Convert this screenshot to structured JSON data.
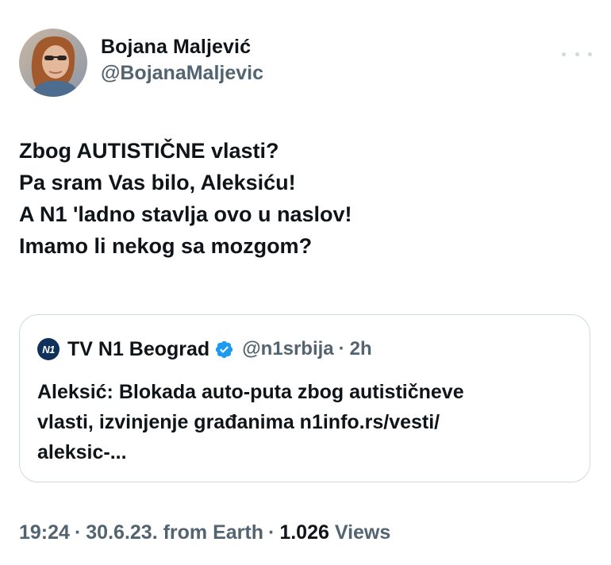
{
  "tweet": {
    "author_name": "Bojana Maljević",
    "author_handle": "@BojanaMaljevic",
    "more_icon": "more-horizontal-icon",
    "text_lines": [
      "Zbog AUTISTIČNE vlasti?",
      "Pa sram Vas bilo, Aleksiću!",
      "A N1 'ladno stavlja ovo u naslov!",
      "Imamo li nekog sa mozgom?"
    ]
  },
  "quote": {
    "logo_text": "N1",
    "name": "TV N1 Beograd",
    "verified_icon": "verified-badge-icon",
    "handle": "@n1srbija",
    "separator": "·",
    "time": "2h",
    "text_lines": [
      "Aleksić: Blokada auto-puta zbog autističneve",
      "vlasti, izvinjenje građanima n1info.rs/vesti/",
      "aleksic-..."
    ]
  },
  "meta": {
    "time": "19:24",
    "sep1": "·",
    "date": "30.6.23.",
    "source": "from Earth",
    "sep2": "·",
    "views_count": "1.026",
    "views_label": "Views"
  },
  "colors": {
    "text": "#0f1419",
    "secondary": "#536471",
    "border": "#cfd9de",
    "verified": "#1d9bf0",
    "n1_brand": "#10315c"
  }
}
